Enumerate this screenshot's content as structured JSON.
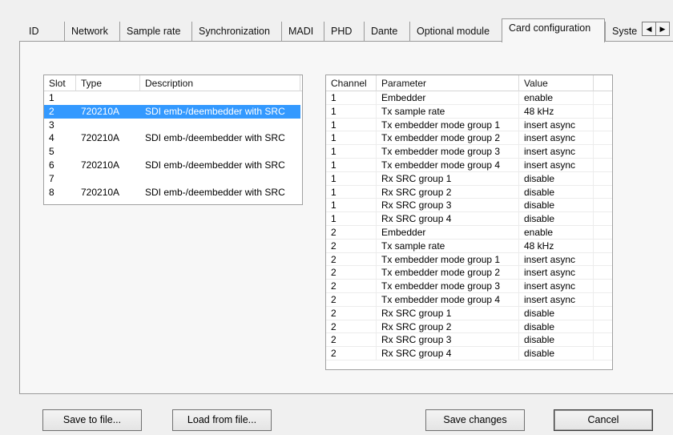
{
  "tabs": [
    {
      "label": "ID"
    },
    {
      "label": "Network"
    },
    {
      "label": "Sample rate"
    },
    {
      "label": "Synchronization"
    },
    {
      "label": "MADI"
    },
    {
      "label": "PHD"
    },
    {
      "label": "Dante"
    },
    {
      "label": "Optional module"
    },
    {
      "label": "Card configuration",
      "active": true
    },
    {
      "label": "Syste"
    }
  ],
  "tab_scroll": {
    "left": "◀",
    "right": "▶"
  },
  "slots_table": {
    "headers": [
      "Slot",
      "Type",
      "Description"
    ],
    "rows": [
      {
        "slot": "1",
        "type": "",
        "description": ""
      },
      {
        "slot": "2",
        "type": "720210A",
        "description": "SDI emb-/deembedder with SRC",
        "selected": true
      },
      {
        "slot": "3",
        "type": "",
        "description": ""
      },
      {
        "slot": "4",
        "type": "720210A",
        "description": "SDI emb-/deembedder with SRC"
      },
      {
        "slot": "5",
        "type": "",
        "description": ""
      },
      {
        "slot": "6",
        "type": "720210A",
        "description": "SDI emb-/deembedder with SRC"
      },
      {
        "slot": "7",
        "type": "",
        "description": ""
      },
      {
        "slot": "8",
        "type": "720210A",
        "description": "SDI emb-/deembedder with SRC"
      }
    ]
  },
  "params_table": {
    "headers": [
      "Channel",
      "Parameter",
      "Value"
    ],
    "rows": [
      {
        "channel": "1",
        "parameter": "Embedder",
        "value": "enable"
      },
      {
        "channel": "1",
        "parameter": "Tx sample rate",
        "value": "48 kHz"
      },
      {
        "channel": "1",
        "parameter": "Tx embedder mode group 1",
        "value": "insert async"
      },
      {
        "channel": "1",
        "parameter": "Tx embedder mode group 2",
        "value": "insert async"
      },
      {
        "channel": "1",
        "parameter": "Tx embedder mode group 3",
        "value": "insert async"
      },
      {
        "channel": "1",
        "parameter": "Tx embedder mode group 4",
        "value": "insert async"
      },
      {
        "channel": "1",
        "parameter": "Rx SRC group 1",
        "value": "disable"
      },
      {
        "channel": "1",
        "parameter": "Rx SRC group 2",
        "value": "disable"
      },
      {
        "channel": "1",
        "parameter": "Rx SRC group 3",
        "value": "disable"
      },
      {
        "channel": "1",
        "parameter": "Rx SRC group 4",
        "value": "disable"
      },
      {
        "channel": "2",
        "parameter": "Embedder",
        "value": "enable"
      },
      {
        "channel": "2",
        "parameter": "Tx sample rate",
        "value": "48 kHz"
      },
      {
        "channel": "2",
        "parameter": "Tx embedder mode group 1",
        "value": "insert async"
      },
      {
        "channel": "2",
        "parameter": "Tx embedder mode group 2",
        "value": "insert async"
      },
      {
        "channel": "2",
        "parameter": "Tx embedder mode group 3",
        "value": "insert async"
      },
      {
        "channel": "2",
        "parameter": "Tx embedder mode group 4",
        "value": "insert async"
      },
      {
        "channel": "2",
        "parameter": "Rx SRC group 1",
        "value": "disable"
      },
      {
        "channel": "2",
        "parameter": "Rx SRC group 2",
        "value": "disable"
      },
      {
        "channel": "2",
        "parameter": "Rx SRC group 3",
        "value": "disable"
      },
      {
        "channel": "2",
        "parameter": "Rx SRC group 4",
        "value": "disable"
      }
    ]
  },
  "buttons": {
    "save_to_file": "Save to file...",
    "load_from_file": "Load from file...",
    "save_changes": "Save changes",
    "cancel": "Cancel"
  },
  "colors": {
    "selection": "#3399ff",
    "window": "#f0f0f0"
  }
}
